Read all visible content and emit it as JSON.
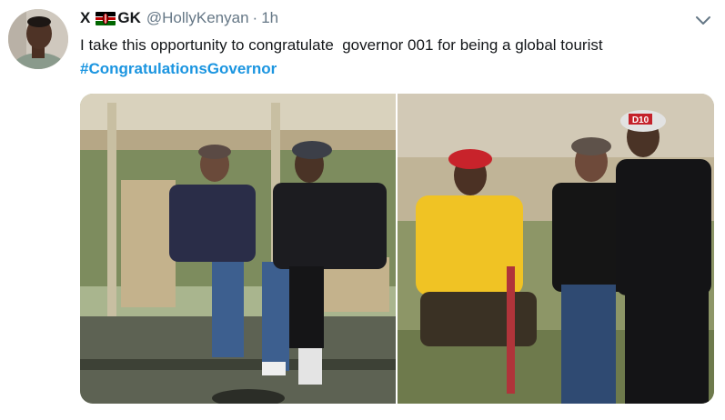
{
  "tweet": {
    "display_name_prefix": "X",
    "display_name_suffix": "GK",
    "handle": "@HollyKenyan",
    "separator": "·",
    "time": "1h",
    "text": "I take this opportunity to congratulate  governor 001 for being a global tourist",
    "hashtag": "#CongratulationsGovernor",
    "flag_icon": "kenya-flag-icon",
    "menu_icon": "chevron-down-icon"
  },
  "media": {
    "photos": [
      {
        "cap_text": ""
      },
      {
        "cap_text": "D10"
      }
    ]
  },
  "colors": {
    "text": "#14171a",
    "muted": "#657786",
    "link": "#1b95e0"
  }
}
